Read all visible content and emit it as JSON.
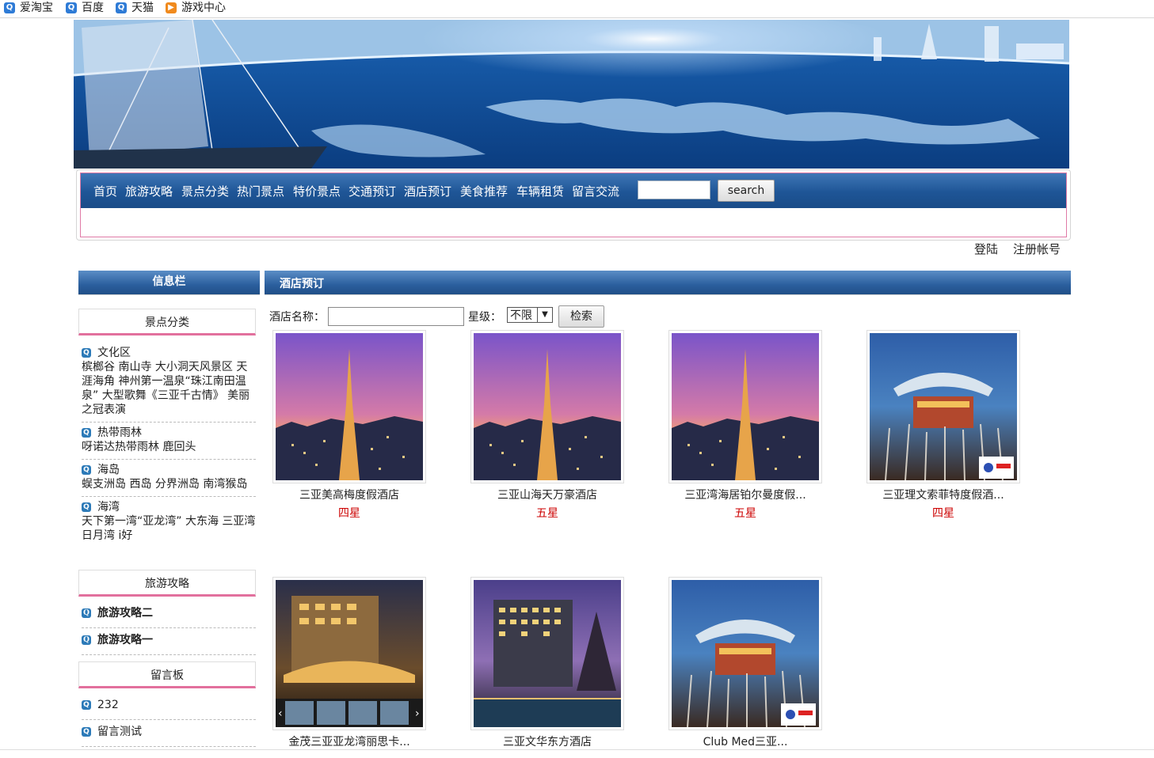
{
  "bookmarks": [
    {
      "label": "爱淘宝",
      "icon": "taobao-icon"
    },
    {
      "label": "百度",
      "icon": "baidu-icon"
    },
    {
      "label": "天猫",
      "icon": "tmall-icon"
    },
    {
      "label": "游戏中心",
      "icon": "game-icon"
    }
  ],
  "nav": {
    "links": [
      "首页",
      "旅游攻略",
      "景点分类",
      "热门景点",
      "特价景点",
      "交通预订",
      "酒店预订",
      "美食推荐",
      "车辆租赁",
      "留言交流"
    ],
    "search_button": "search"
  },
  "auth": {
    "login": "登陆",
    "register": "注册帐号"
  },
  "sidebar": {
    "title": "信息栏",
    "categories_title": "景点分类",
    "categories": [
      {
        "title": "文化区",
        "items": "槟榔谷 南山寺 大小洞天风景区 天涯海角 神州第一温泉“珠江南田温泉” 大型歌舞《三亚千古情》 美丽之冠表演"
      },
      {
        "title": "热带雨林",
        "items": "呀诺达热带雨林 鹿回头"
      },
      {
        "title": "海岛",
        "items": "蜈支洲岛 西岛 分界洲岛 南湾猴岛"
      },
      {
        "title": "海湾",
        "items": "天下第一湾“亚龙湾” 大东海 三亚湾 日月湾 i好"
      }
    ],
    "guides_title": "旅游攻略",
    "guides": [
      "旅游攻略二",
      "旅游攻略一"
    ],
    "board_title": "留言板",
    "board": [
      "232",
      "留言测试"
    ]
  },
  "main": {
    "title": "酒店预订",
    "filter": {
      "name_label": "酒店名称：",
      "star_label": "星级：",
      "star_value": "不限",
      "search_button": "检索"
    },
    "hotels": [
      {
        "name": "三亚美高梅度假酒店",
        "star": "四星",
        "img": "tower"
      },
      {
        "name": "三亚山海天万豪酒店",
        "star": "五星",
        "img": "tower"
      },
      {
        "name": "三亚湾海居铂尔曼度假...",
        "star": "五星",
        "img": "tower"
      },
      {
        "name": "三亚理文索菲特度假酒...",
        "star": "四星",
        "img": "fountain"
      },
      {
        "name": "金茂三亚亚龙湾丽思卡...",
        "star": "",
        "img": "hotel-night"
      },
      {
        "name": "三亚文华东方酒店",
        "star": "",
        "img": "resort"
      },
      {
        "name": "Club Med三亚...",
        "star": "",
        "img": "fountain"
      }
    ]
  },
  "colors": {
    "nav_blue": "#1e5596",
    "accent_pink": "#e2709d",
    "star_red": "#cc0000"
  }
}
